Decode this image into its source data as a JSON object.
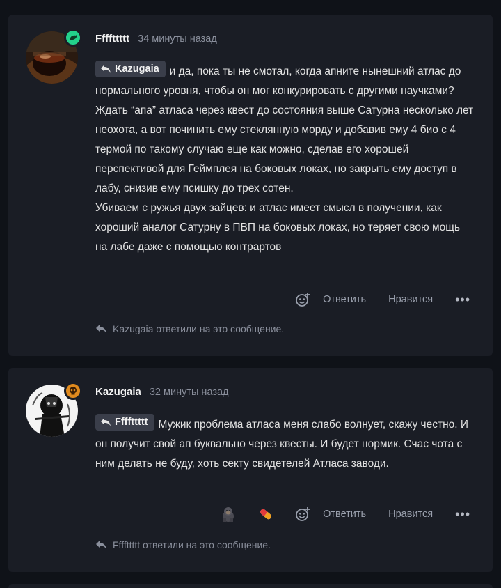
{
  "comments": [
    {
      "author": "Ffffttttt",
      "time": "34 минуты назад",
      "reply_to": "Kazugaia",
      "text_lines": [
        "и да, пока ты не смотал, когда апните нынешний атлас до нормального уровня, чтобы он мог конкурировать с другими научками? Ждать “апа” атласа через квест до состояния выше Сатурна несколько лет неохота, а вот починить ему стеклянную морду и добавив ему 4 био с 4 термой по такому случаю еще как можно, сделав его хорошей перспективой для Геймплея на боковых локах, но закрыть ему доступ в лабу, снизив ему псишку до трех сотен.",
        "Убиваем с ружья двух зайцев: и атлас имеет смысл в получении, как хороший аналог Сатурну в ПВП на боковых локах, но теряет свою мощь на лабе даже с помощью контрартов"
      ],
      "actions": {
        "reply": "Ответить",
        "like": "Нравится",
        "more": "•••"
      },
      "replied_notice": "Kazugaia ответили на это сообщение.",
      "badge_color": "#23d18b"
    },
    {
      "author": "Kazugaia",
      "time": "32 минуты назад",
      "reply_to": "Ffffttttt",
      "text_lines": [
        "Мужик проблема атласа меня слабо волнует, скажу честно. И он получит свой ап буквально через квесты. И будет нормик. Счас чота с ним делать не буду, хоть секту свидетелей Атласа заводи."
      ],
      "reactions": [
        "gorilla-emoji",
        "pill-emoji"
      ],
      "actions": {
        "reply": "Ответить",
        "like": "Нравится",
        "more": "•••"
      },
      "replied_notice": "Ffffttttt ответили на это сообщение.",
      "badge_color": "#e08a1e"
    }
  ]
}
